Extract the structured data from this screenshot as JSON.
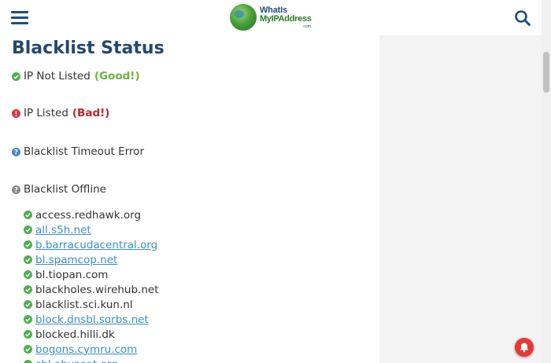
{
  "header": {
    "logo_line1": "WhatIs",
    "logo_line2": "MyIPAddress",
    "logo_suffix": ".com",
    "accent_color": "#1f4e79"
  },
  "main": {
    "title": "Blacklist Status",
    "legend": [
      {
        "icon": "check-icon",
        "label": "IP Not Listed",
        "tag": "(Good!)",
        "tag_color": "#6db33f"
      },
      {
        "icon": "alert-icon",
        "label": "IP Listed",
        "tag": "(Bad!)",
        "tag_color": "#c0262d"
      },
      {
        "icon": "question-icon",
        "label": "Blacklist Timeout Error"
      },
      {
        "icon": "offline-icon",
        "label": "Blacklist Offline"
      }
    ],
    "blacklists": [
      {
        "name": "access.redhawk.org",
        "link": false
      },
      {
        "name": "all.s5h.net",
        "link": true
      },
      {
        "name": "b.barracudacentral.org",
        "link": true
      },
      {
        "name": "bl.spamcop.net",
        "link": true
      },
      {
        "name": "bl.tiopan.com",
        "link": false
      },
      {
        "name": "blackholes.wirehub.net",
        "link": false
      },
      {
        "name": "blacklist.sci.kun.nl",
        "link": false
      },
      {
        "name": "block.dnsbl.sorbs.net",
        "link": true
      },
      {
        "name": "blocked.hilli.dk",
        "link": false
      },
      {
        "name": "bogons.cymru.com",
        "link": true
      },
      {
        "name": "cbl.abuseat.org",
        "link": true
      }
    ]
  }
}
